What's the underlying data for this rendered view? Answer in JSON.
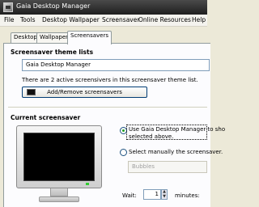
{
  "window": {
    "title": "Gaia Desktop Manager",
    "icon": "app-monitor-icon"
  },
  "menu": [
    "File",
    "Tools",
    "Desktop Wallpaper",
    "Screensaver",
    "Online Resources",
    "Help"
  ],
  "tabs": [
    "Desktop",
    "Wallpapers",
    "Screensavers"
  ],
  "active_tab": "Screensavers",
  "theme_section": {
    "title": "Screensaver theme lists",
    "selected_theme": "Gaia Desktop Manager",
    "info": "There are 2 active screensivers in this screensaver theme list.",
    "add_remove_label": "Add/Remove screensavers",
    "add_remove_icon": "screen-icon"
  },
  "current_section": {
    "title": "Current screensaver",
    "option_gaia": "Use Gaia Desktop Manager to sho",
    "option_gaia_line2": "selected above.",
    "option_manual": "Select manually the screensaver.",
    "manual_select_value": "Bubbles",
    "wait_label": "Wait:",
    "wait_value": "1",
    "wait_unit": "minutes:"
  }
}
